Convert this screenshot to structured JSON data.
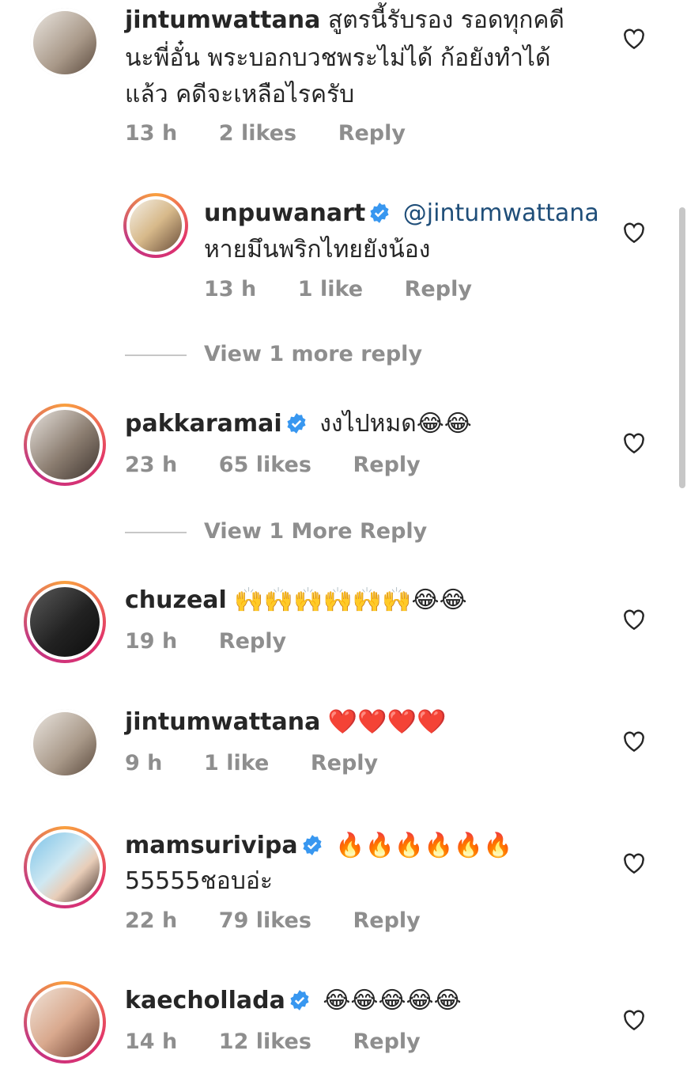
{
  "comments": [
    {
      "username": "jintumwattana",
      "lines": [
        "สูตรนี้รับรอง รอดทุกคดี",
        "นะพี่อั๋น พระบอกบวชพระไม่ได้ ก้อยังทำได้",
        "แล้ว คดีจะเหลือไรครับ"
      ],
      "time": "13 h",
      "likes": "2 likes",
      "reply": "Reply"
    },
    {
      "username": "unpuwanart",
      "mention": "@jintumwattana",
      "lines": [
        "หายมึนพริกไทยยังน้อง"
      ],
      "time": "13 h",
      "likes": "1 like",
      "reply": "Reply"
    },
    {
      "username": "pakkaramai",
      "lines": [
        "งงไปหมด😂😂"
      ],
      "time": "23 h",
      "likes": "65 likes",
      "reply": "Reply"
    },
    {
      "username": "chuzeal",
      "lines": [
        "🙌🙌🙌🙌🙌🙌😂😂"
      ],
      "time": "19 h",
      "reply": "Reply"
    },
    {
      "username": "jintumwattana",
      "lines": [
        "❤️❤️❤️❤️"
      ],
      "time": "9 h",
      "likes": "1 like",
      "reply": "Reply"
    },
    {
      "username": "mamsurivipa",
      "lines": [
        "🔥🔥🔥🔥🔥🔥",
        "55555ชอบอ่ะ"
      ],
      "time": "22 h",
      "likes": "79 likes",
      "reply": "Reply"
    },
    {
      "username": "kaechollada",
      "lines": [
        "😂😂😂😂😂"
      ],
      "time": "14 h",
      "likes": "12 likes",
      "reply": "Reply"
    }
  ],
  "view_more": [
    "View 1 more reply",
    "View 1 More Reply"
  ],
  "colors": {
    "mention": "#1f4e79",
    "meta": "#8e8e8e",
    "verified": "#3897f0"
  },
  "icons": {
    "like": "heart-outline-icon",
    "verified": "verified-badge-icon"
  }
}
